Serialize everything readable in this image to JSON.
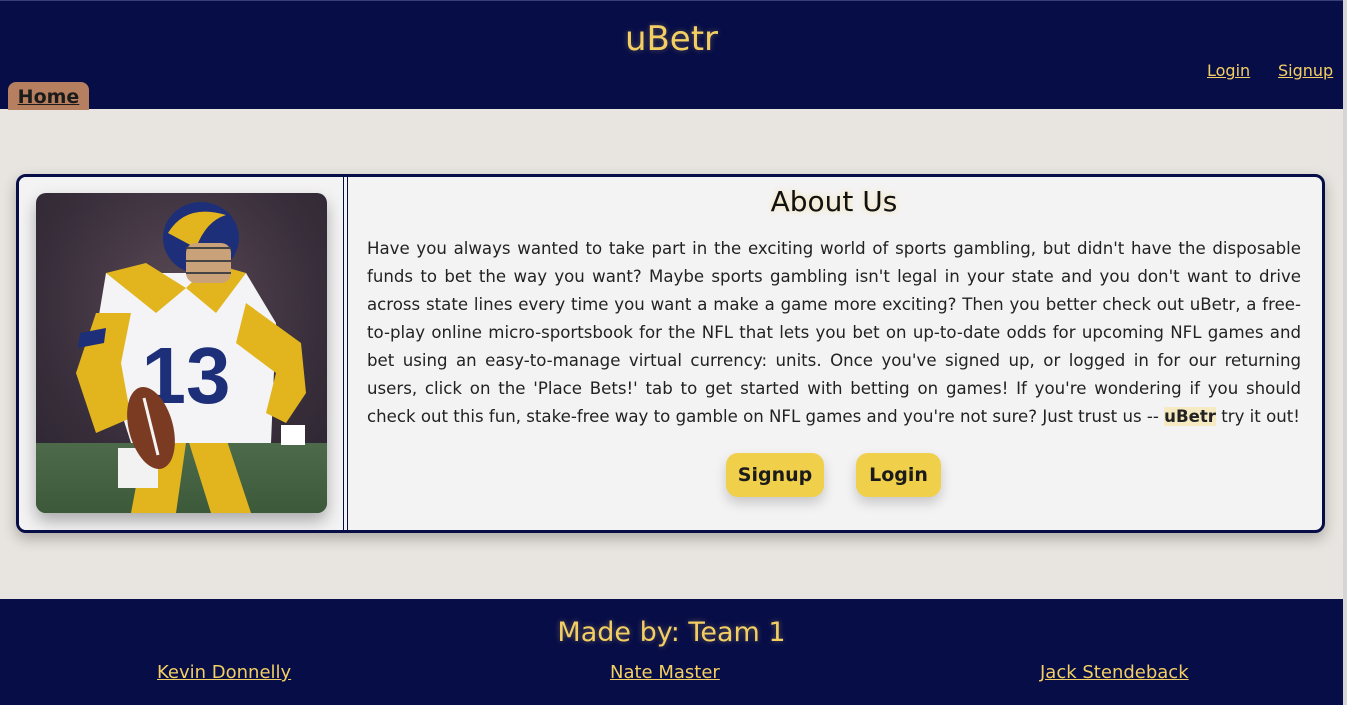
{
  "header": {
    "title": "uBetr",
    "login_label": "Login",
    "signup_label": "Signup",
    "home_tab": "Home"
  },
  "about": {
    "heading": "About Us",
    "body_part1": "Have you always wanted to take part in the exciting world of sports gambling, but didn't have the disposable funds to bet the way you want? Maybe sports gambling isn't legal in your state and you don't want to drive across state lines every time you want a make a game more exciting? Then you better check out uBetr, a free-to-play online micro-sportsbook for the NFL that lets you bet on up-to-date odds for upcoming NFL games and bet using an easy-to-manage virtual currency: units. Once you've signed up, or logged in for our returning users, click on the 'Place Bets!' tab to get started with betting on games! If you're wondering if you should check out this fun, stake-free way to gamble on NFL games and you're not sure? Just trust us -- ",
    "brand": "uBetr",
    "body_part2": " try it out!",
    "signup_label": "Signup",
    "login_label": "Login",
    "jersey_number": "13"
  },
  "footer": {
    "title": "Made by: Team 1",
    "members": [
      "Kevin Donnelly",
      "Nate Master",
      "Jack Stendeback"
    ]
  },
  "colors": {
    "navy": "#070d47",
    "gold": "#f3cf63",
    "button": "#f0cf4a",
    "tab": "#b57f60",
    "page_bg": "#e8e4df"
  }
}
